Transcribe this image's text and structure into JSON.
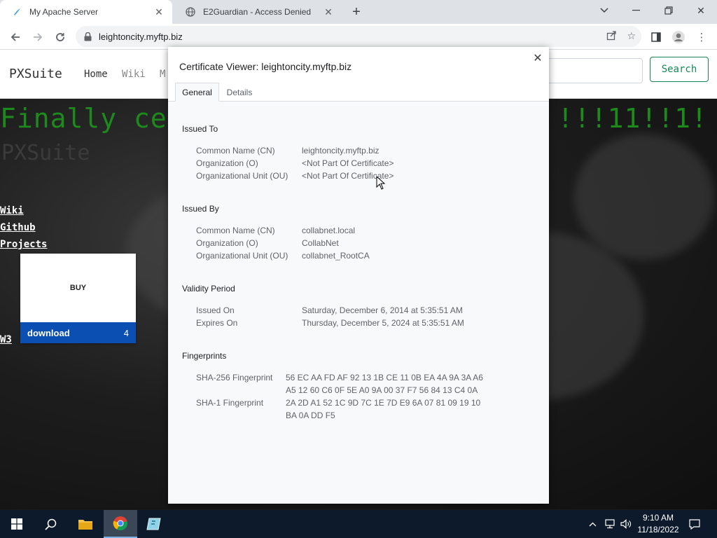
{
  "browser": {
    "tabs": [
      {
        "title": "My Apache Server",
        "active": true,
        "icon": "apache-feather-icon"
      },
      {
        "title": "E2Guardian - Access Denied",
        "active": false,
        "icon": "globe-icon"
      }
    ],
    "url": "leightoncity.myftp.biz"
  },
  "page": {
    "brand": "PXSuite",
    "nav": [
      "Home",
      "Wiki",
      "M"
    ],
    "search_label": "Search",
    "headline_left": "Finally ce",
    "headline_right": "!!!11!!1!",
    "subhead": "PXSuite",
    "links": [
      "Wiki",
      "Github",
      "Projects",
      "W3"
    ],
    "card": {
      "buy": "BUY",
      "download": "download",
      "count": "4"
    }
  },
  "dialog": {
    "title": "Certificate Viewer: leightoncity.myftp.biz",
    "tabs": [
      "General",
      "Details"
    ],
    "sections": {
      "issued_to": {
        "heading": "Issued To",
        "rows": [
          {
            "label": "Common Name (CN)",
            "value": "leightoncity.myftp.biz"
          },
          {
            "label": "Organization (O)",
            "value": "<Not Part Of Certificate>"
          },
          {
            "label": "Organizational Unit (OU)",
            "value": "<Not Part Of Certificate>"
          }
        ]
      },
      "issued_by": {
        "heading": "Issued By",
        "rows": [
          {
            "label": "Common Name (CN)",
            "value": "collabnet.local"
          },
          {
            "label": "Organization (O)",
            "value": "CollabNet"
          },
          {
            "label": "Organizational Unit (OU)",
            "value": "collabnet_RootCA"
          }
        ]
      },
      "validity": {
        "heading": "Validity Period",
        "rows": [
          {
            "label": "Issued On",
            "value": "Saturday, December 6, 2014 at 5:35:51 AM"
          },
          {
            "label": "Expires On",
            "value": "Thursday, December 5, 2024 at 5:35:51 AM"
          }
        ]
      },
      "fingerprints": {
        "heading": "Fingerprints",
        "rows": [
          {
            "label": "SHA-256 Fingerprint",
            "line1": "56 EC AA FD AF 92 13 1B CE 11 0B EA 4A 9A 3A A6",
            "line2": "A5 12 60 C6 0F 5E A0 9A 00 37 F7 56 84 13 C4 0A"
          },
          {
            "label": "SHA-1 Fingerprint",
            "line1": "2A 2D A1 52 1C 9D 7C 1E 7D E9 6A 07 81 09 19 10",
            "line2": "BA 0A DD F5"
          }
        ]
      }
    }
  },
  "taskbar": {
    "time": "9:10 AM",
    "date": "11/18/2022"
  }
}
